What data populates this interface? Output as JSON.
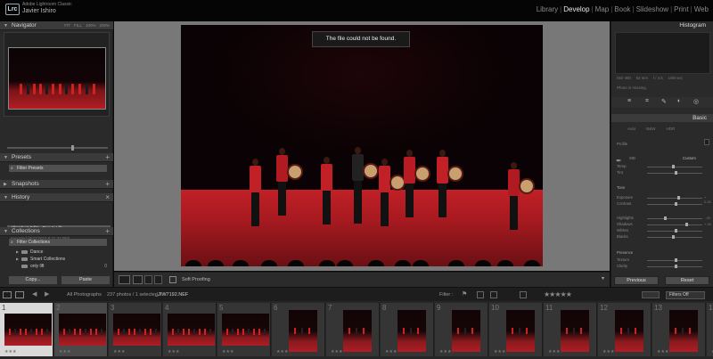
{
  "topbar": {
    "logo": "Lrc",
    "app_name": "Adobe Lightroom Classic",
    "user_name": "Javier Ishiro",
    "modules": [
      "Library",
      "Develop",
      "Map",
      "Book",
      "Slideshow",
      "Print",
      "Web"
    ],
    "active_module": "Develop"
  },
  "left_panel": {
    "navigator": {
      "title": "Navigator",
      "options": [
        "FIT",
        "FILL",
        "100%",
        "200%"
      ]
    },
    "presets": {
      "title": "Presets",
      "filter_placeholder": "Filter Presets"
    },
    "snapshots": {
      "title": "Snapshots"
    },
    "history": {
      "title": "History",
      "items": [
        {
          "label": "Aftershoot Edits - True to Life",
          "selected": true
        },
        {
          "label": "Aftershoot Edits - True to Life",
          "selected": false
        },
        {
          "label": "Imported (9/27/2023 8:31:37 PM)",
          "selected": false
        }
      ]
    },
    "collections": {
      "title": "Collections",
      "filter_placeholder": "Filter Collections",
      "items": [
        {
          "label": "Dance",
          "count": ""
        },
        {
          "label": "Smart Collections",
          "count": ""
        },
        {
          "label": "only lift",
          "count": "0"
        }
      ]
    },
    "copy_label": "Copy...",
    "paste_label": "Paste"
  },
  "center": {
    "toast": "The file could not be found.",
    "toolbar": {
      "soft_proofing": "Soft Proofing",
      "menu_icon": "triangle-down-icon"
    }
  },
  "right_panel": {
    "histogram_title": "Histogram",
    "histogram_info": [
      "ISO 400",
      "63 mm",
      "f / 4.5",
      "1/80 sec"
    ],
    "missing_text": "Photo is missing",
    "basic_title": "Basic",
    "treatment": [
      "Auto",
      "B&W",
      "HDR"
    ],
    "profile_label": "Profile",
    "wb_label": "WB",
    "wb_value": "Custom",
    "sliders": [
      {
        "label": "Temp",
        "value": "",
        "pos": 0.45
      },
      {
        "label": "Tint",
        "value": "",
        "pos": 0.5
      },
      {
        "label": "Exposure",
        "value": "+ 0.26",
        "pos": 0.55
      },
      {
        "label": "Contrast",
        "value": "",
        "pos": 0.5
      },
      {
        "label": "Highlights",
        "value": "- 45",
        "pos": 0.3
      },
      {
        "label": "Shadows",
        "value": "+ 40",
        "pos": 0.7
      },
      {
        "label": "Whites",
        "value": "",
        "pos": 0.5
      },
      {
        "label": "Blacks",
        "value": "",
        "pos": 0.45
      },
      {
        "label": "Texture",
        "value": "",
        "pos": 0.5
      },
      {
        "label": "Clarity",
        "value": "",
        "pos": 0.5
      }
    ],
    "section_tone": "Tone",
    "section_presence": "Presence",
    "previous_label": "Previous",
    "reset_label": "Reset"
  },
  "filmstrip_header": {
    "source": "All Photographs",
    "count": "237 photos / 1 selected /",
    "file": "_JIW7192.NEF",
    "filter_label": "Filter :",
    "filters_off": "Filters Off"
  },
  "filmstrip": {
    "cells": [
      {
        "num": "1",
        "orient": "h",
        "selected": true
      },
      {
        "num": "2",
        "orient": "h",
        "selected": false
      },
      {
        "num": "3",
        "orient": "h",
        "selected": false
      },
      {
        "num": "4",
        "orient": "h",
        "selected": false
      },
      {
        "num": "5",
        "orient": "h",
        "selected": false
      },
      {
        "num": "6",
        "orient": "v",
        "selected": false
      },
      {
        "num": "7",
        "orient": "v",
        "selected": false
      },
      {
        "num": "8",
        "orient": "v",
        "selected": false
      },
      {
        "num": "9",
        "orient": "v",
        "selected": false
      },
      {
        "num": "10",
        "orient": "v",
        "selected": false
      },
      {
        "num": "11",
        "orient": "v",
        "selected": false
      },
      {
        "num": "12",
        "orient": "v",
        "selected": false
      },
      {
        "num": "13",
        "orient": "v",
        "selected": false
      },
      {
        "num": "14",
        "orient": "v",
        "selected": false
      }
    ],
    "stars": "★★★"
  },
  "colors": {
    "accent": "#e8e8e8",
    "stage_red": "#c12026",
    "panel": "#2a2a2a"
  }
}
